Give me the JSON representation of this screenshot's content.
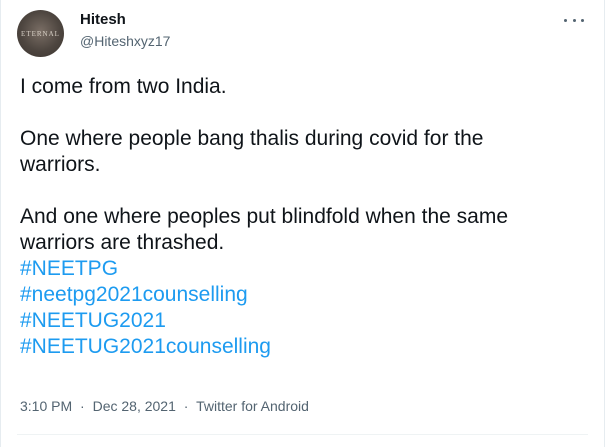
{
  "author": {
    "display_name": "Hitesh",
    "handle": "@Hiteshxyz17",
    "avatar_text": "ETERNAL"
  },
  "menu": {
    "icon": "more-horizontal-icon"
  },
  "tweet": {
    "lines": [
      "I come from two India.",
      "One where people bang thalis during covid for the",
      "warriors.",
      "And one where peoples put blindfold when the same",
      "warriors are thrashed."
    ],
    "hashtags": [
      "#NEETPG",
      "#neetpg2021counselling",
      "#NEETUG2021",
      "#NEETUG2021counselling"
    ]
  },
  "meta": {
    "time": "3:10 PM",
    "separator": "·",
    "date": "Dec 28, 2021",
    "source": "Twitter for Android"
  },
  "colors": {
    "text": "#0f1419",
    "secondary": "#536471",
    "link": "#1d9bf0"
  }
}
